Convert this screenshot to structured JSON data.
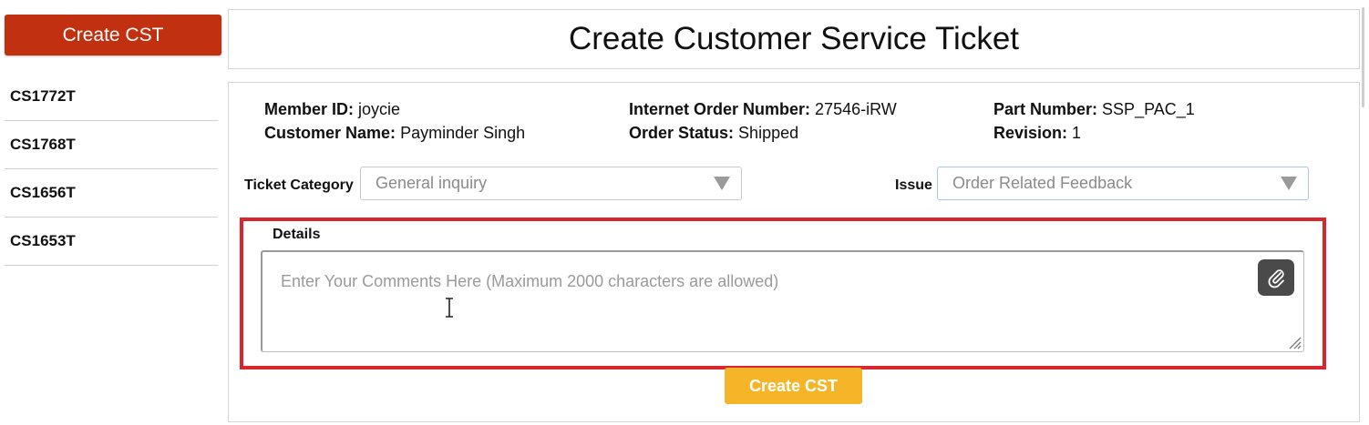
{
  "sidebar": {
    "create_button_label": "Create CST",
    "tickets": [
      {
        "id": "CS1772T"
      },
      {
        "id": "CS1768T"
      },
      {
        "id": "CS1656T"
      },
      {
        "id": "CS1653T"
      }
    ]
  },
  "header": {
    "title": "Create Customer Service Ticket"
  },
  "order_info": {
    "member_id_label": "Member ID:",
    "member_id": "joycie",
    "customer_name_label": "Customer Name:",
    "customer_name": "Payminder Singh",
    "internet_order_label": "Internet Order Number:",
    "internet_order": "27546-iRW",
    "order_status_label": "Order Status:",
    "order_status": "Shipped",
    "part_number_label": "Part Number:",
    "part_number": "SSP_PAC_1",
    "revision_label": "Revision:",
    "revision": "1"
  },
  "form": {
    "ticket_category_label": "Ticket Category",
    "ticket_category_value": "General inquiry",
    "issue_label": "Issue",
    "issue_value": "Order Related Feedback",
    "details_label": "Details",
    "details_placeholder": "Enter Your Comments Here (Maximum 2000 characters are allowed)",
    "submit_label": "Create CST"
  },
  "colors": {
    "create_button": "#c1300f",
    "submit_button": "#f6b428",
    "highlight_frame": "#d9262e"
  },
  "icons": {
    "attach": "paperclip-icon",
    "caret": "chevron-down-icon"
  }
}
